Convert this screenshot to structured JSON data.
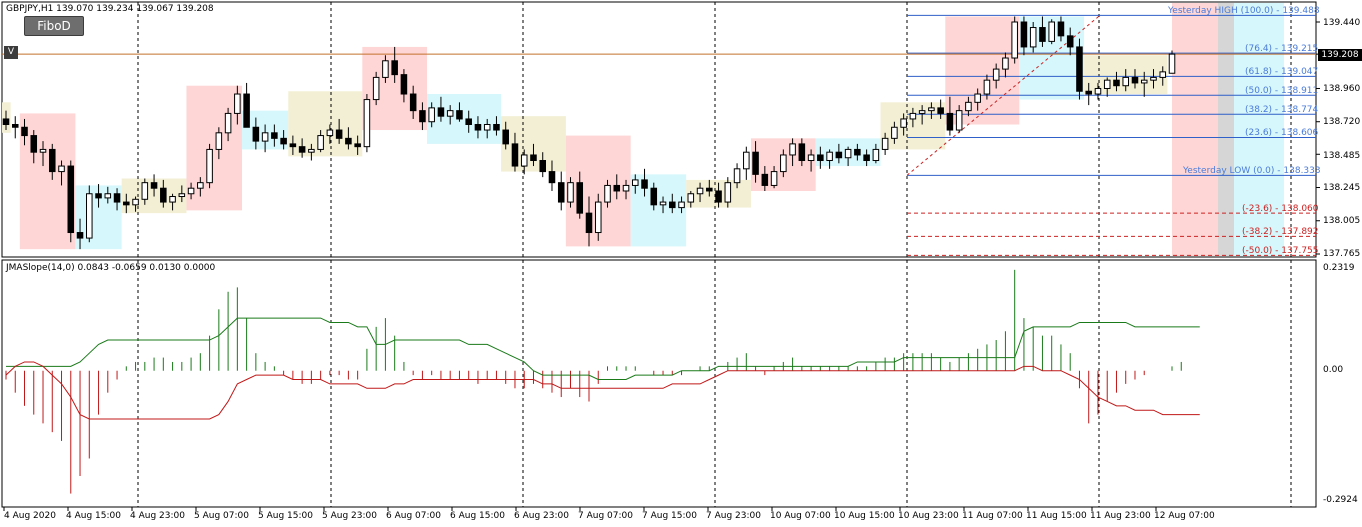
{
  "header": {
    "title": "GBPJPY,H1  139.070 139.234 139.067 139.208",
    "button": "FiboD",
    "marker": "V"
  },
  "price_axis": {
    "ticks": [
      "139.440",
      "139.208",
      "138.960",
      "138.720",
      "138.485",
      "138.245",
      "138.005",
      "137.765"
    ],
    "current_price": "139.208"
  },
  "indicator": {
    "title": "JMASlope(14,0) 0.0843 -0.0659 0.0130 0.0000",
    "ticks": [
      "0.2319",
      "0.00",
      "-0.2924"
    ]
  },
  "time_axis": {
    "ticks": [
      "4 Aug 2020",
      "4 Aug 15:00",
      "4 Aug 23:00",
      "5 Aug 07:00",
      "5 Aug 15:00",
      "5 Aug 23:00",
      "6 Aug 07:00",
      "6 Aug 15:00",
      "6 Aug 23:00",
      "7 Aug 07:00",
      "7 Aug 15:00",
      "7 Aug 23:00",
      "10 Aug 07:00",
      "10 Aug 15:00",
      "10 Aug 23:00",
      "11 Aug 07:00",
      "11 Aug 15:00",
      "11 Aug 23:00",
      "12 Aug 07:00"
    ]
  },
  "fibo_labels": [
    {
      "text": "Yesterday HIGH (100.0) -  139.488",
      "color": "#4a7bd8"
    },
    {
      "text": "(76.4) -  139.215",
      "color": "#4a7bd8"
    },
    {
      "text": "(61.8) -  139.047",
      "color": "#4a7bd8"
    },
    {
      "text": "(50.0) -  138.911",
      "color": "#4a7bd8"
    },
    {
      "text": "(38.2) -  138.774",
      "color": "#4a7bd8"
    },
    {
      "text": "(23.6) -  138.606",
      "color": "#4a7bd8"
    },
    {
      "text": "Yesterday LOW (0.0) -  138.333",
      "color": "#4a7bd8"
    },
    {
      "text": "(-23.6) -  138.060",
      "color": "#cc2222"
    },
    {
      "text": "(-38.2) -  137.892",
      "color": "#cc2222"
    },
    {
      "text": "(-50.0) -  137.755",
      "color": "#cc2222"
    }
  ],
  "colors": {
    "up": "#000000",
    "down": "#000000",
    "pink": "#ffd6d6",
    "beige": "#f3efd4",
    "cyan": "#d6f7fb",
    "fibo": "#2f5fc8",
    "neg": "#cc2222",
    "green": "#1a7a1a",
    "red": "#c01818",
    "orange": "#c0702a"
  },
  "chart_data": {
    "type": "candlestick",
    "symbol": "GBPJPY",
    "timeframe": "H1",
    "ylim": [
      137.765,
      139.44
    ],
    "candles": [
      [
        138.74,
        138.8,
        138.66,
        138.7
      ],
      [
        138.7,
        138.76,
        138.6,
        138.68
      ],
      [
        138.68,
        138.74,
        138.55,
        138.62
      ],
      [
        138.62,
        138.66,
        138.42,
        138.5
      ],
      [
        138.5,
        138.58,
        138.4,
        138.52
      ],
      [
        138.52,
        138.56,
        138.3,
        138.36
      ],
      [
        138.36,
        138.44,
        138.26,
        138.4
      ],
      [
        138.4,
        138.44,
        137.85,
        137.92
      ],
      [
        137.92,
        138.02,
        137.8,
        137.88
      ],
      [
        137.88,
        138.26,
        137.85,
        138.2
      ],
      [
        138.2,
        138.27,
        138.1,
        138.17
      ],
      [
        138.17,
        138.25,
        138.13,
        138.2
      ],
      [
        138.2,
        138.24,
        138.08,
        138.14
      ],
      [
        138.14,
        138.2,
        138.06,
        138.12
      ],
      [
        138.12,
        138.18,
        138.07,
        138.16
      ],
      [
        138.16,
        138.31,
        138.12,
        138.28
      ],
      [
        138.28,
        138.34,
        138.18,
        138.24
      ],
      [
        138.24,
        138.3,
        138.1,
        138.14
      ],
      [
        138.14,
        138.2,
        138.08,
        138.18
      ],
      [
        138.18,
        138.26,
        138.14,
        138.2
      ],
      [
        138.2,
        138.28,
        138.16,
        138.24
      ],
      [
        138.24,
        138.32,
        138.18,
        138.28
      ],
      [
        138.28,
        138.56,
        138.24,
        138.52
      ],
      [
        138.52,
        138.68,
        138.45,
        138.64
      ],
      [
        138.64,
        138.82,
        138.58,
        138.78
      ],
      [
        138.78,
        138.98,
        138.7,
        138.92
      ],
      [
        138.92,
        139.0,
        138.72,
        138.68
      ],
      [
        138.68,
        138.75,
        138.52,
        138.58
      ],
      [
        138.58,
        138.7,
        138.5,
        138.64
      ],
      [
        138.64,
        138.7,
        138.54,
        138.6
      ],
      [
        138.6,
        138.66,
        138.52,
        138.56
      ],
      [
        138.56,
        138.62,
        138.48,
        138.54
      ],
      [
        138.54,
        138.6,
        138.46,
        138.5
      ],
      [
        138.5,
        138.56,
        138.44,
        138.52
      ],
      [
        138.52,
        138.66,
        138.5,
        138.62
      ],
      [
        138.62,
        138.7,
        138.56,
        138.66
      ],
      [
        138.66,
        138.74,
        138.56,
        138.6
      ],
      [
        138.6,
        138.68,
        138.52,
        138.56
      ],
      [
        138.56,
        138.62,
        138.48,
        138.54
      ],
      [
        138.54,
        138.92,
        138.5,
        138.88
      ],
      [
        138.88,
        139.08,
        138.84,
        139.04
      ],
      [
        139.04,
        139.2,
        139.0,
        139.16
      ],
      [
        139.16,
        139.26,
        139.0,
        139.06
      ],
      [
        139.06,
        139.1,
        138.86,
        138.92
      ],
      [
        138.92,
        138.98,
        138.74,
        138.8
      ],
      [
        138.8,
        138.86,
        138.66,
        138.72
      ],
      [
        138.72,
        138.86,
        138.68,
        138.82
      ],
      [
        138.82,
        138.9,
        138.72,
        138.76
      ],
      [
        138.76,
        138.84,
        138.7,
        138.8
      ],
      [
        138.8,
        138.86,
        138.72,
        138.74
      ],
      [
        138.74,
        138.8,
        138.64,
        138.7
      ],
      [
        138.7,
        138.76,
        138.6,
        138.66
      ],
      [
        138.66,
        138.74,
        138.6,
        138.7
      ],
      [
        138.7,
        138.76,
        138.62,
        138.66
      ],
      [
        138.66,
        138.72,
        138.52,
        138.56
      ],
      [
        138.56,
        138.64,
        138.36,
        138.4
      ],
      [
        138.4,
        138.52,
        138.34,
        138.48
      ],
      [
        138.48,
        138.56,
        138.4,
        138.44
      ],
      [
        138.44,
        138.5,
        138.32,
        138.36
      ],
      [
        138.36,
        138.44,
        138.22,
        138.28
      ],
      [
        138.28,
        138.36,
        138.08,
        138.14
      ],
      [
        138.14,
        138.32,
        138.1,
        138.28
      ],
      [
        138.28,
        138.36,
        138.02,
        138.06
      ],
      [
        138.06,
        138.18,
        137.82,
        137.92
      ],
      [
        137.92,
        138.2,
        137.86,
        138.14
      ],
      [
        138.14,
        138.3,
        138.1,
        138.26
      ],
      [
        138.26,
        138.34,
        138.16,
        138.22
      ],
      [
        138.22,
        138.3,
        138.16,
        138.26
      ],
      [
        138.26,
        138.34,
        138.2,
        138.3
      ],
      [
        138.3,
        138.38,
        138.18,
        138.24
      ],
      [
        138.24,
        138.28,
        138.08,
        138.12
      ],
      [
        138.12,
        138.18,
        138.06,
        138.14
      ],
      [
        138.14,
        138.2,
        138.06,
        138.1
      ],
      [
        138.1,
        138.18,
        138.06,
        138.14
      ],
      [
        138.14,
        138.22,
        138.1,
        138.2
      ],
      [
        138.2,
        138.28,
        138.14,
        138.24
      ],
      [
        138.24,
        138.3,
        138.18,
        138.22
      ],
      [
        138.22,
        138.28,
        138.1,
        138.14
      ],
      [
        138.14,
        138.32,
        138.1,
        138.28
      ],
      [
        138.28,
        138.42,
        138.24,
        138.38
      ],
      [
        138.38,
        138.54,
        138.3,
        138.5
      ],
      [
        138.5,
        138.58,
        138.28,
        138.34
      ],
      [
        138.34,
        138.4,
        138.22,
        138.26
      ],
      [
        138.26,
        138.4,
        138.24,
        138.36
      ],
      [
        138.36,
        138.52,
        138.32,
        138.48
      ],
      [
        138.48,
        138.6,
        138.4,
        138.56
      ],
      [
        138.56,
        138.6,
        138.4,
        138.44
      ],
      [
        138.44,
        138.52,
        138.36,
        138.48
      ],
      [
        138.48,
        138.54,
        138.38,
        138.44
      ],
      [
        138.44,
        138.52,
        138.38,
        138.5
      ],
      [
        138.5,
        138.56,
        138.42,
        138.46
      ],
      [
        138.46,
        138.54,
        138.4,
        138.52
      ],
      [
        138.52,
        138.56,
        138.44,
        138.48
      ],
      [
        138.48,
        138.52,
        138.4,
        138.44
      ],
      [
        138.44,
        138.56,
        138.42,
        138.52
      ],
      [
        138.52,
        138.64,
        138.48,
        138.6
      ],
      [
        138.6,
        138.72,
        138.56,
        138.68
      ],
      [
        138.68,
        138.78,
        138.62,
        138.74
      ],
      [
        138.74,
        138.82,
        138.68,
        138.78
      ],
      [
        138.78,
        138.84,
        138.7,
        138.8
      ],
      [
        138.8,
        138.86,
        138.74,
        138.82
      ],
      [
        138.82,
        138.88,
        138.74,
        138.78
      ],
      [
        138.78,
        138.9,
        138.62,
        138.66
      ],
      [
        138.66,
        138.84,
        138.64,
        138.8
      ],
      [
        138.8,
        138.9,
        138.76,
        138.86
      ],
      [
        138.86,
        138.96,
        138.8,
        138.92
      ],
      [
        138.92,
        139.06,
        138.88,
        139.02
      ],
      [
        139.02,
        139.14,
        138.96,
        139.1
      ],
      [
        139.1,
        139.22,
        139.04,
        139.18
      ],
      [
        139.18,
        139.48,
        139.14,
        139.44
      ],
      [
        139.44,
        139.48,
        139.2,
        139.26
      ],
      [
        139.26,
        139.44,
        139.22,
        139.4
      ],
      [
        139.4,
        139.48,
        139.26,
        139.3
      ],
      [
        139.3,
        139.46,
        139.28,
        139.44
      ],
      [
        139.44,
        139.48,
        139.3,
        139.34
      ],
      [
        139.34,
        139.4,
        139.2,
        139.26
      ],
      [
        139.26,
        139.32,
        138.88,
        138.94
      ],
      [
        138.94,
        139.0,
        138.84,
        138.92
      ],
      [
        138.92,
        139.0,
        138.88,
        138.96
      ],
      [
        138.96,
        139.04,
        138.9,
        139.02
      ],
      [
        139.02,
        139.08,
        138.94,
        138.98
      ],
      [
        138.98,
        139.1,
        138.94,
        139.04
      ],
      [
        139.04,
        139.1,
        138.96,
        139.0
      ],
      [
        139.0,
        139.08,
        138.9,
        139.02
      ],
      [
        139.02,
        139.1,
        138.96,
        139.04
      ],
      [
        139.04,
        139.12,
        138.98,
        139.08
      ],
      [
        139.07,
        139.234,
        139.067,
        139.208
      ]
    ],
    "indicator": {
      "name": "JMASlope(14,0)",
      "ylim": [
        -0.2924,
        0.2319
      ],
      "values": [
        -0.02,
        -0.05,
        -0.08,
        -0.1,
        -0.12,
        -0.14,
        -0.16,
        -0.28,
        -0.24,
        -0.2,
        -0.1,
        -0.05,
        -0.02,
        0.01,
        0.02,
        0.02,
        0.03,
        0.03,
        0.02,
        0.02,
        0.03,
        0.04,
        0.08,
        0.14,
        0.18,
        0.19,
        0.12,
        0.04,
        0.02,
        0.01,
        -0.01,
        -0.02,
        -0.03,
        -0.03,
        -0.02,
        -0.01,
        -0.01,
        -0.02,
        -0.02,
        0.05,
        0.1,
        0.12,
        0.08,
        0.02,
        -0.01,
        -0.02,
        -0.01,
        -0.02,
        -0.02,
        -0.02,
        -0.02,
        -0.03,
        -0.02,
        -0.02,
        -0.03,
        -0.04,
        -0.04,
        -0.03,
        -0.04,
        -0.05,
        -0.06,
        -0.04,
        -0.06,
        -0.07,
        -0.03,
        0.01,
        0.01,
        0.01,
        0.01,
        0.0,
        -0.01,
        -0.01,
        -0.01,
        -0.01,
        0.0,
        0.01,
        0.01,
        0.0,
        0.02,
        0.03,
        0.04,
        0.01,
        -0.01,
        0.01,
        0.02,
        0.03,
        0.01,
        0.01,
        0.01,
        0.01,
        0.01,
        0.01,
        0.01,
        0.01,
        0.02,
        0.03,
        0.03,
        0.04,
        0.04,
        0.04,
        0.04,
        0.03,
        0.02,
        0.03,
        0.04,
        0.05,
        0.06,
        0.07,
        0.09,
        0.23,
        0.12,
        0.1,
        0.08,
        0.08,
        0.06,
        0.04,
        -0.04,
        -0.12,
        -0.1,
        -0.07,
        -0.05,
        -0.03,
        -0.02,
        -0.01,
        0.0,
        0.0,
        0.01,
        0.02
      ],
      "upper_band": [
        0.01,
        0.01,
        0.01,
        0.01,
        0.01,
        0.01,
        0.01,
        0.01,
        0.02,
        0.04,
        0.06,
        0.07,
        0.07,
        0.07,
        0.07,
        0.07,
        0.07,
        0.07,
        0.07,
        0.07,
        0.07,
        0.07,
        0.07,
        0.08,
        0.1,
        0.12,
        0.12,
        0.12,
        0.12,
        0.12,
        0.12,
        0.12,
        0.12,
        0.12,
        0.12,
        0.11,
        0.11,
        0.11,
        0.1,
        0.1,
        0.06,
        0.06,
        0.07,
        0.07,
        0.07,
        0.07,
        0.07,
        0.07,
        0.07,
        0.07,
        0.06,
        0.06,
        0.06,
        0.05,
        0.04,
        0.03,
        0.02,
        0.0,
        -0.01,
        -0.01,
        -0.01,
        -0.01,
        -0.01,
        -0.01,
        -0.02,
        -0.02,
        -0.02,
        -0.02,
        -0.01,
        -0.01,
        -0.01,
        -0.01,
        -0.01,
        0.0,
        0.0,
        0.0,
        0.0,
        0.01,
        0.01,
        0.01,
        0.01,
        0.01,
        0.01,
        0.01,
        0.01,
        0.01,
        0.01,
        0.01,
        0.01,
        0.01,
        0.01,
        0.01,
        0.02,
        0.02,
        0.02,
        0.02,
        0.02,
        0.03,
        0.03,
        0.03,
        0.03,
        0.03,
        0.03,
        0.03,
        0.03,
        0.03,
        0.03,
        0.03,
        0.03,
        0.03,
        0.09,
        0.1,
        0.1,
        0.1,
        0.1,
        0.1,
        0.11,
        0.11,
        0.11,
        0.11,
        0.11,
        0.11,
        0.1,
        0.1,
        0.1,
        0.1,
        0.1,
        0.1,
        0.1,
        0.1
      ],
      "lower_band": [
        -0.01,
        0.01,
        0.02,
        0.02,
        0.01,
        -0.01,
        -0.03,
        -0.06,
        -0.1,
        -0.11,
        -0.11,
        -0.11,
        -0.11,
        -0.11,
        -0.11,
        -0.11,
        -0.11,
        -0.11,
        -0.11,
        -0.11,
        -0.11,
        -0.11,
        -0.11,
        -0.1,
        -0.07,
        -0.03,
        -0.02,
        -0.01,
        -0.01,
        -0.01,
        -0.01,
        -0.02,
        -0.02,
        -0.02,
        -0.02,
        -0.03,
        -0.03,
        -0.03,
        -0.03,
        -0.04,
        -0.04,
        -0.04,
        -0.03,
        -0.03,
        -0.02,
        -0.02,
        -0.02,
        -0.02,
        -0.02,
        -0.02,
        -0.02,
        -0.02,
        -0.02,
        -0.02,
        -0.02,
        -0.02,
        -0.02,
        -0.02,
        -0.03,
        -0.03,
        -0.04,
        -0.04,
        -0.04,
        -0.04,
        -0.04,
        -0.04,
        -0.04,
        -0.04,
        -0.04,
        -0.04,
        -0.04,
        -0.04,
        -0.03,
        -0.03,
        -0.03,
        -0.03,
        -0.02,
        -0.01,
        0.0,
        0.0,
        0.0,
        0.0,
        0.0,
        0.0,
        0.0,
        0.0,
        0.0,
        0.0,
        0.0,
        0.0,
        0.0,
        0.0,
        0.0,
        0.0,
        0.0,
        0.0,
        0.0,
        0.0,
        0.0,
        0.0,
        0.0,
        0.0,
        0.0,
        0.0,
        0.0,
        0.0,
        0.0,
        0.0,
        0.0,
        0.0,
        0.01,
        0.01,
        0.0,
        0.0,
        0.0,
        -0.01,
        -0.02,
        -0.04,
        -0.06,
        -0.07,
        -0.08,
        -0.08,
        -0.09,
        -0.09,
        -0.09,
        -0.1,
        -0.1,
        -0.1,
        -0.1,
        -0.1
      ]
    }
  }
}
